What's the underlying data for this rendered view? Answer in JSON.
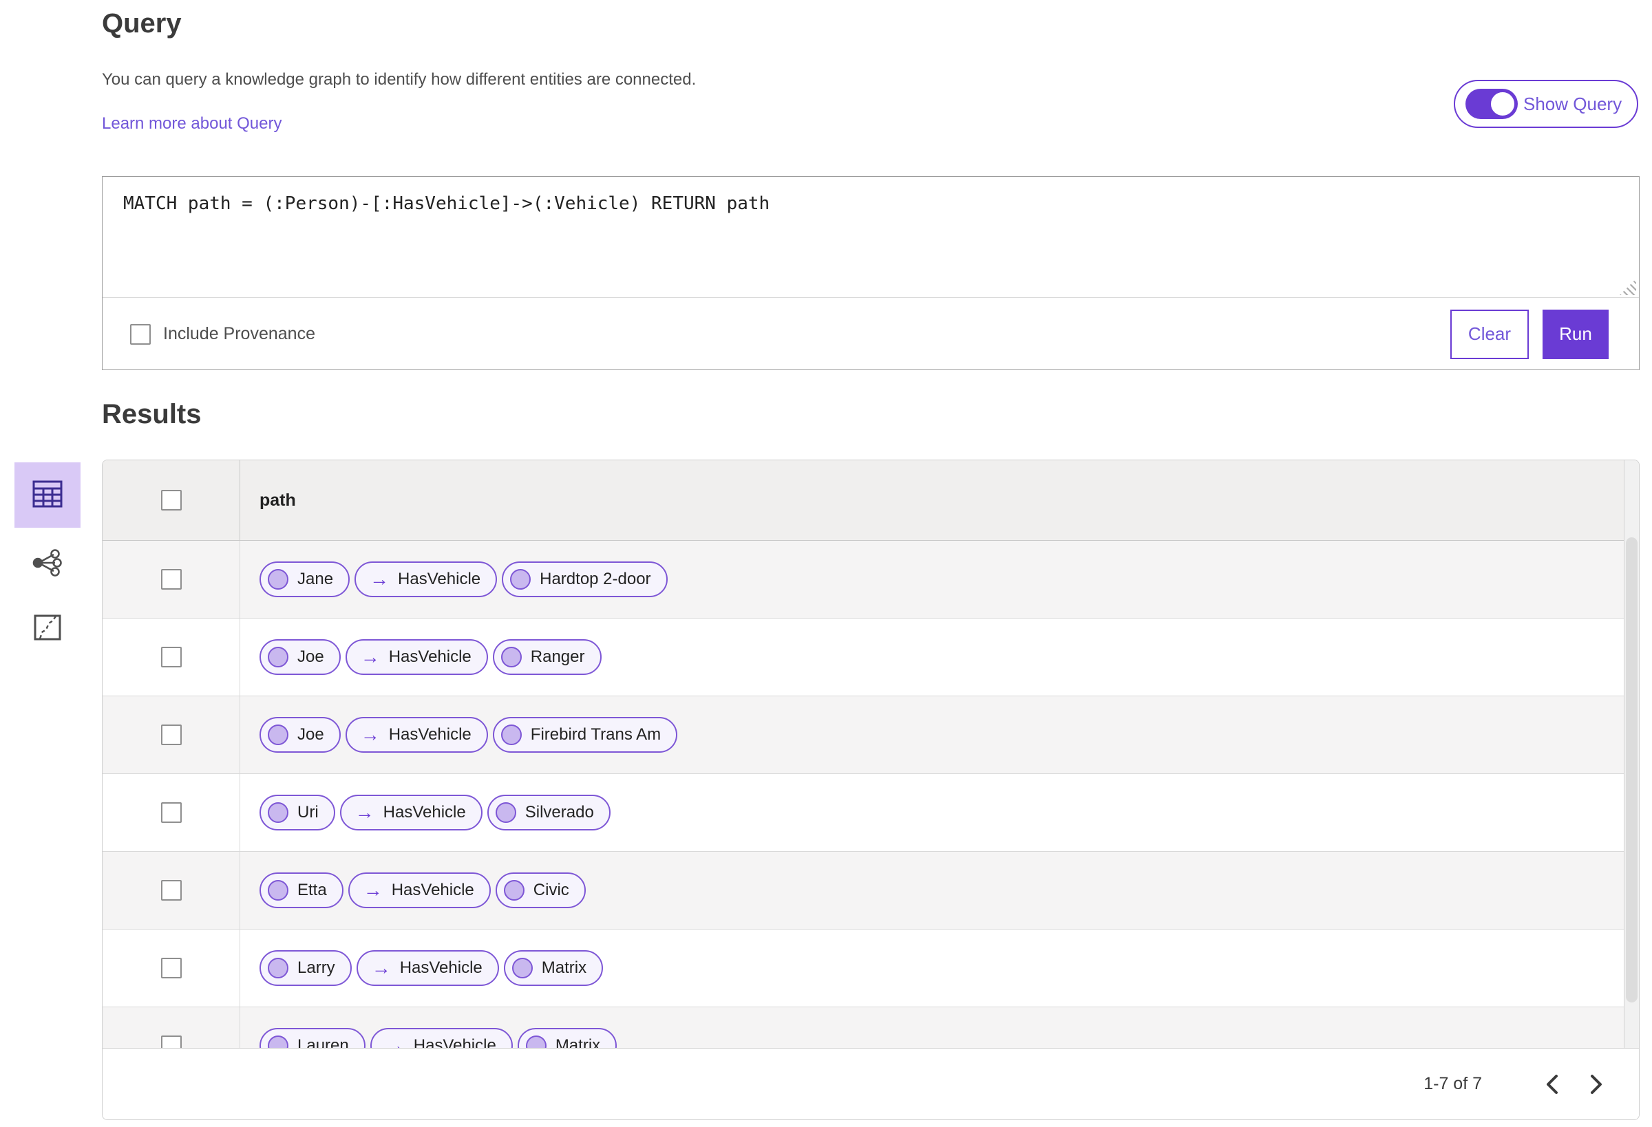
{
  "header": {
    "title": "Query",
    "description": "You can query a knowledge graph to identify how different entities are connected.",
    "learn_more": "Learn more about Query",
    "show_query": {
      "label": "Show Query",
      "state": "on",
      "icon": "toggle-on-icon"
    }
  },
  "query_panel": {
    "query_text": "MATCH path = (:Person)-[:HasVehicle]->(:Vehicle) RETURN path",
    "include_provenance": {
      "label": "Include Provenance",
      "checked": false
    },
    "clear_label": "Clear",
    "run_label": "Run"
  },
  "results": {
    "title": "Results",
    "column_header": "path",
    "arrow_glyph": "→",
    "rows": [
      {
        "source": "Jane",
        "relationship": "HasVehicle",
        "target": "Hardtop 2-door"
      },
      {
        "source": "Joe",
        "relationship": "HasVehicle",
        "target": "Ranger"
      },
      {
        "source": "Joe",
        "relationship": "HasVehicle",
        "target": "Firebird Trans Am"
      },
      {
        "source": "Uri",
        "relationship": "HasVehicle",
        "target": "Silverado"
      },
      {
        "source": "Etta",
        "relationship": "HasVehicle",
        "target": "Civic"
      },
      {
        "source": "Larry",
        "relationship": "HasVehicle",
        "target": "Matrix"
      },
      {
        "source": "Lauren",
        "relationship": "HasVehicle",
        "target": "Matrix"
      }
    ],
    "pagination": {
      "range_label": "1-7 of 7",
      "prev_icon": "chevron-left-icon",
      "next_icon": "chevron-right-icon"
    }
  },
  "sidebar": {
    "tools": [
      {
        "name": "table-view",
        "icon": "table-icon",
        "selected": true
      },
      {
        "name": "link-chart-view",
        "icon": "link-chart-icon",
        "selected": false
      },
      {
        "name": "map-view",
        "icon": "map-icon",
        "selected": false
      }
    ]
  },
  "colors": {
    "accent": "#6a3bd4",
    "link": "#7257d9",
    "pill_border": "#7e57d6",
    "pill_bg": "#f6f4fd",
    "pill_node_fill": "#c9b8ef",
    "selected_tool_bg": "#d9c9f6"
  }
}
